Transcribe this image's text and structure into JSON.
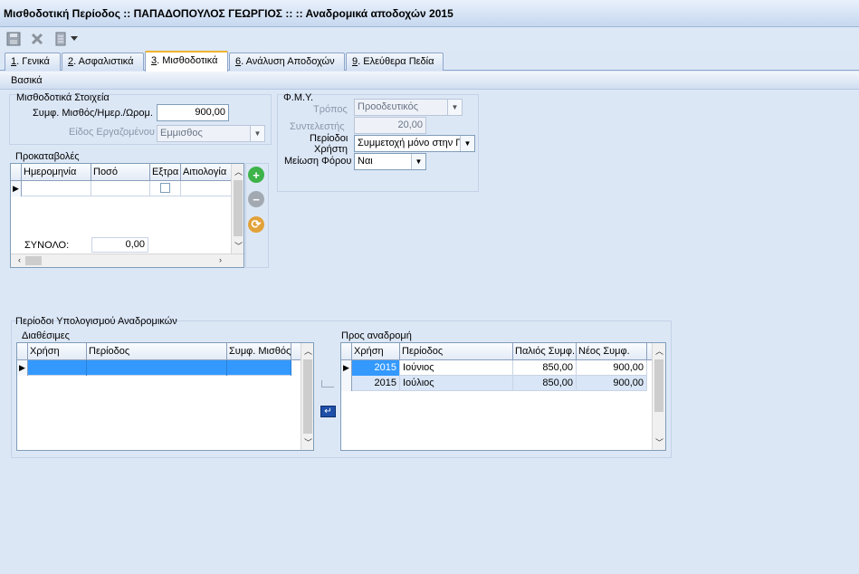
{
  "window": {
    "title": "Μισθοδοτική Περίοδος :: ΠΑΠΑΔΟΠΟΥΛΟΣ ΓΕΩΡΓΙΟΣ ::  :: Αναδρομικά αποδοχών 2015"
  },
  "tabs": [
    {
      "key": "1",
      "label": ". Γενικά"
    },
    {
      "key": "2",
      "label": ". Ασφαλιστικά"
    },
    {
      "key": "3",
      "label": ". Μισθοδοτικά"
    },
    {
      "key": "6",
      "label": ". Ανάλυση Αποδοχών"
    },
    {
      "key": "9",
      "label": ". Ελεύθερα Πεδία"
    }
  ],
  "section": {
    "title": "Βασικά"
  },
  "payroll": {
    "group_title": "Μισθοδοτικά Στοιχεία",
    "salary_label": "Συμφ. Μισθός/Ημερ./Ωρομ.",
    "salary_value": "900,00",
    "employee_type_label": "Είδος Εργαζομένου",
    "employee_type_value": "Εμμισθος"
  },
  "fmy": {
    "group_title": "Φ.Μ.Υ.",
    "method_label": "Τρόπος",
    "method_value": "Προοδευτικός",
    "coefficient_label": "Συντελεστής",
    "coefficient_value": "20,00",
    "period_use_label_1": "Περίοδοι",
    "period_use_label_2": "Χρήστη",
    "period_use_value": "Συμμετοχή μόνο στην Γ",
    "tax_reduction_label": "Μείωση Φόρου",
    "tax_reduction_value": "Ναι"
  },
  "advances": {
    "group_title": "Προκαταβολές",
    "columns": [
      "Ημερομηνία",
      "Ποσό",
      "Εξτρα",
      "Αιτιολογία"
    ],
    "total_label": "ΣΥΝΟΛΟ:",
    "total_value": "0,00"
  },
  "retro": {
    "group_title": "Περίοδοι Υπολογισμού Αναδρομικών",
    "available_title": "Διαθέσιμες",
    "available_columns": [
      "Χρήση",
      "Περίοδος",
      "Συμφ. Μισθός"
    ],
    "selected_title": "Προς αναδρομή",
    "selected_columns": [
      "Χρήση",
      "Περίοδος",
      "Παλιός Συμφ.",
      "Νέος Συμφ."
    ],
    "selected_rows": [
      {
        "year": "2015",
        "period": "Ιούνιος",
        "old": "850,00",
        "new": "900,00"
      },
      {
        "year": "2015",
        "period": "Ιούλιος",
        "old": "850,00",
        "new": "900,00"
      }
    ]
  },
  "colors": {
    "accent": "#f0b432",
    "selection": "#3399ff",
    "background": "#dce7f6"
  }
}
